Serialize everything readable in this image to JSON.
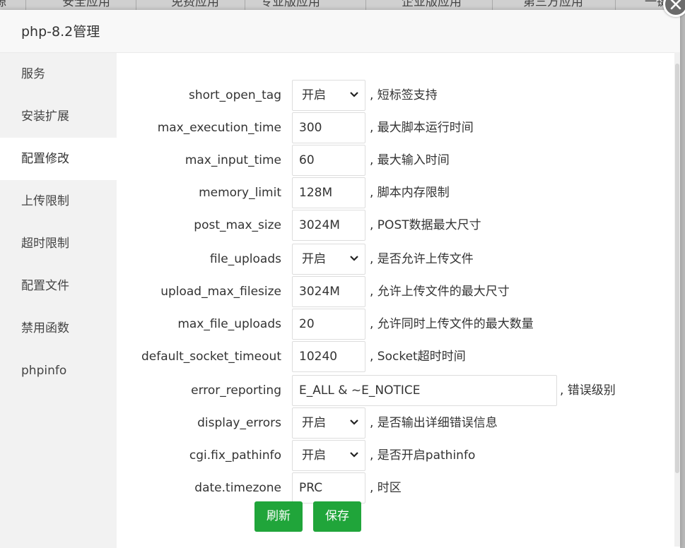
{
  "background_tabs": [
    "源",
    "安全应用",
    "免费应用",
    "专业版应用",
    "企业版应用",
    "第三方应用",
    "一键"
  ],
  "modal": {
    "title": "php-8.2管理"
  },
  "sidebar": {
    "items": [
      {
        "label": "服务",
        "active": false
      },
      {
        "label": "安装扩展",
        "active": false
      },
      {
        "label": "配置修改",
        "active": true
      },
      {
        "label": "上传限制",
        "active": false
      },
      {
        "label": "超时限制",
        "active": false
      },
      {
        "label": "配置文件",
        "active": false
      },
      {
        "label": "禁用函数",
        "active": false
      },
      {
        "label": "phpinfo",
        "active": false
      }
    ]
  },
  "settings": [
    {
      "key": "short_open_tag",
      "type": "select",
      "value": "开启",
      "desc": ", 短标签支持"
    },
    {
      "key": "max_execution_time",
      "type": "input",
      "value": "300",
      "desc": ", 最大脚本运行时间"
    },
    {
      "key": "max_input_time",
      "type": "input",
      "value": "60",
      "desc": ", 最大输入时间"
    },
    {
      "key": "memory_limit",
      "type": "input",
      "value": "128M",
      "desc": ", 脚本内存限制"
    },
    {
      "key": "post_max_size",
      "type": "input",
      "value": "3024M",
      "desc": ", POST数据最大尺寸"
    },
    {
      "key": "file_uploads",
      "type": "select",
      "value": "开启",
      "desc": ", 是否允许上传文件"
    },
    {
      "key": "upload_max_filesize",
      "type": "input",
      "value": "3024M",
      "desc": ", 允许上传文件的最大尺寸"
    },
    {
      "key": "max_file_uploads",
      "type": "input",
      "value": "20",
      "desc": ", 允许同时上传文件的最大数量"
    },
    {
      "key": "default_socket_timeout",
      "type": "input",
      "value": "10240",
      "desc": ", Socket超时时间"
    },
    {
      "key": "error_reporting",
      "type": "wide",
      "value": "E_ALL & ~E_NOTICE",
      "desc": ", 错误级别"
    },
    {
      "key": "display_errors",
      "type": "select",
      "value": "开启",
      "desc": ", 是否输出详细错误信息"
    },
    {
      "key": "cgi.fix_pathinfo",
      "type": "select",
      "value": "开启",
      "desc": ", 是否开启pathinfo"
    },
    {
      "key": "date.timezone",
      "type": "input",
      "value": "PRC",
      "desc": ", 时区"
    }
  ],
  "buttons": {
    "refresh": "刷新",
    "save": "保存"
  },
  "colors": {
    "accent": "#20a53a"
  }
}
